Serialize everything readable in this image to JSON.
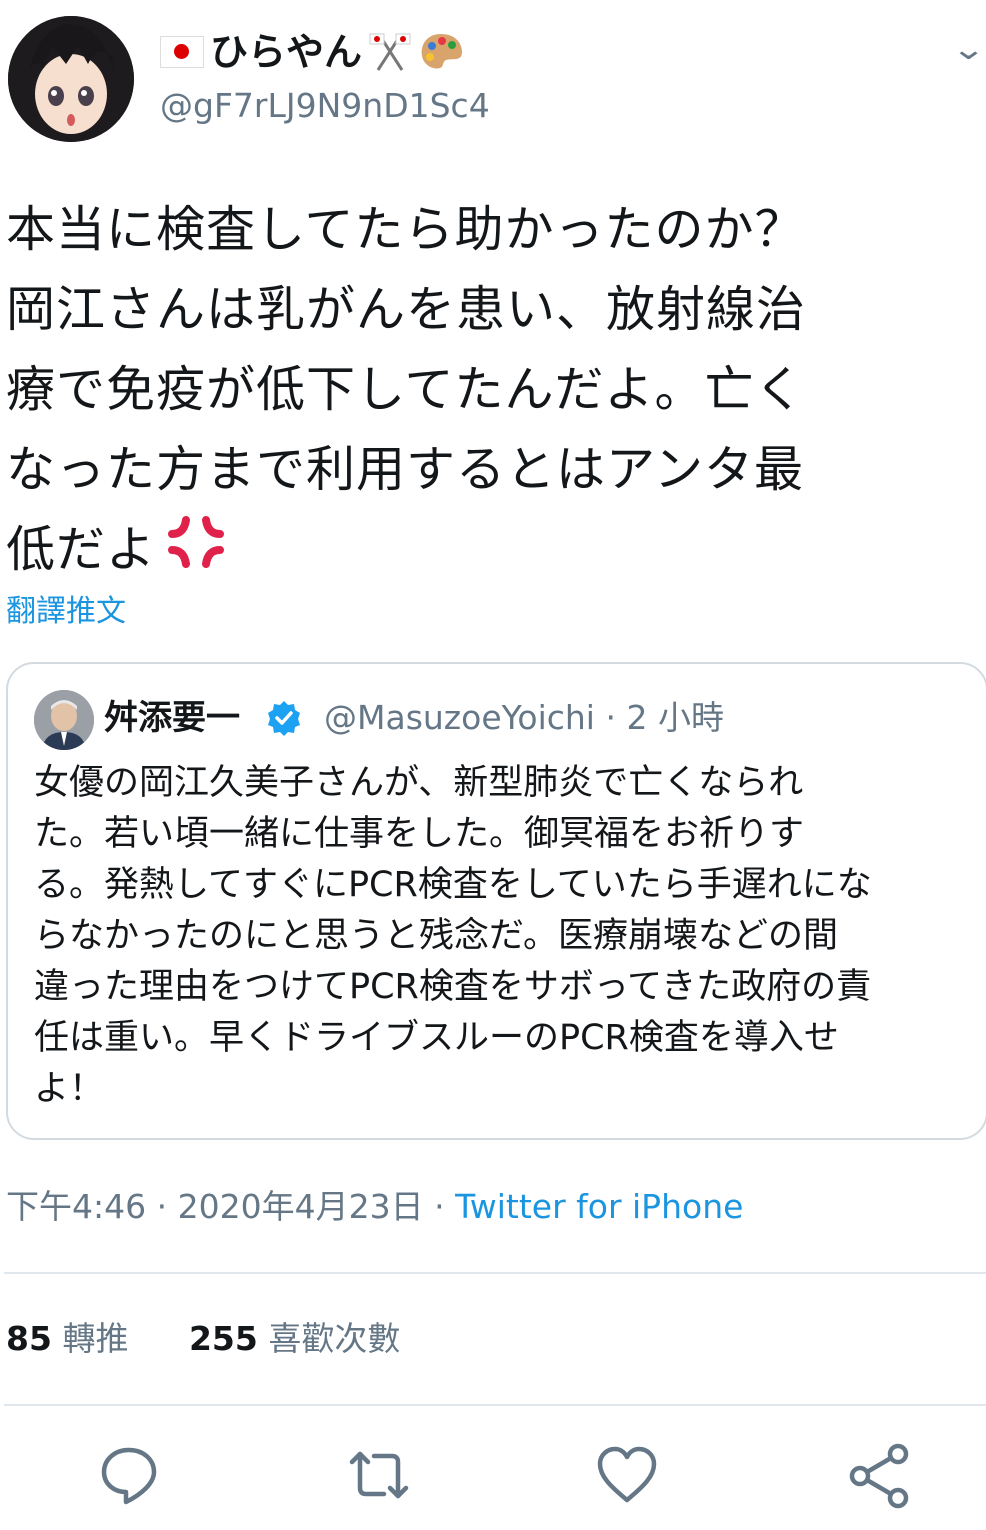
{
  "user": {
    "display_name": "ひらやん",
    "handle": "@gF7rLJ9N9nD1Sc4"
  },
  "tweet": {
    "text": "本当に検査してたら助かったのか？\n岡江さんは乳がんを患い、放射線治\n療で免疫が低下してたんだよ。亡く\nなった方まで利用するとはアンタ最\n低だよ",
    "translate_label": "翻譯推文"
  },
  "quote": {
    "name": "舛添要一",
    "handle": "@MasuzoeYoichi",
    "time": "· 2 小時",
    "text": "女優の岡江久美子さんが、新型肺炎で亡くなられ\nた。若い頃一緒に仕事をした。御冥福をお祈りす\nる。発熱してすぐにPCR検査をしていたら手遅れにな\nらなかったのにと思うと残念だ。医療崩壊などの間\n違った理由をつけてPCR検査をサボってきた政府の責\n任は重い。早くドライブスルーのPCR検査を導入せ\nよ！"
  },
  "meta": {
    "time": "下午4:46",
    "sep1": " · ",
    "date": "2020年4月23日",
    "sep2": " · ",
    "source": "Twitter for iPhone"
  },
  "stats": {
    "retweets_count": "85",
    "retweets_label": "轉推",
    "likes_count": "255",
    "likes_label": "喜歡次數"
  },
  "icons": {
    "reply": "reply-icon",
    "retweet": "retweet-icon",
    "like": "heart-icon",
    "share": "share-icon",
    "anger": "anger-symbol-icon",
    "verified": "verified-badge-icon"
  },
  "colors": {
    "link": "#1b95e0",
    "secondary": "#657786",
    "anger": "#e0224a",
    "verified": "#1da1f2"
  }
}
